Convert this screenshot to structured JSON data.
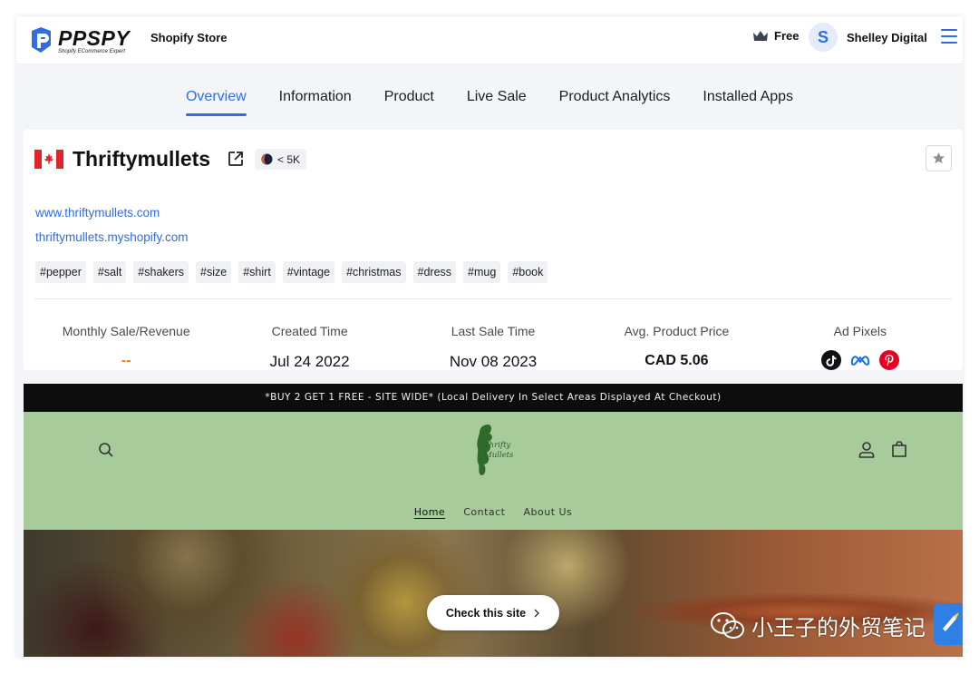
{
  "header": {
    "logo_text": "PPSPY",
    "logo_tagline": "Shopify ECommerce Expert",
    "page_type": "Shopify Store",
    "plan_label": "Free",
    "user_initial": "S",
    "user_name": "Shelley Digital",
    "accent_color": "#2f6de1"
  },
  "tabs": [
    {
      "label": "Overview",
      "active": true
    },
    {
      "label": "Information",
      "active": false
    },
    {
      "label": "Product",
      "active": false
    },
    {
      "label": "Live Sale",
      "active": false
    },
    {
      "label": "Product Analytics",
      "active": false
    },
    {
      "label": "Installed Apps",
      "active": false
    }
  ],
  "store": {
    "country_flag": "canada-flag-icon",
    "name": "Thriftymullets",
    "traffic_badge": "< 5K",
    "domains": [
      "www.thriftymullets.com",
      "thriftymullets.myshopify.com"
    ],
    "tags": [
      "pepper",
      "salt",
      "shakers",
      "size",
      "shirt",
      "vintage",
      "christmas",
      "dress",
      "mug",
      "book"
    ],
    "tag_prefix": "#"
  },
  "stats": {
    "monthly": {
      "label": "Monthly Sale/Revenue",
      "value": "--"
    },
    "created": {
      "label": "Created Time",
      "value": "Jul 24 2022"
    },
    "last_sale": {
      "label": "Last Sale Time",
      "value": "Nov 08 2023"
    },
    "avg_price": {
      "label": "Avg. Product Price",
      "value": "CAD 5.06"
    },
    "ad_pixels": {
      "label": "Ad Pixels",
      "icons": [
        "tiktok-icon",
        "meta-icon",
        "pinterest-icon"
      ]
    }
  },
  "preview": {
    "announcement": "*BUY 2 GET 1 FREE - SITE WIDE* (Local Delivery In Select Areas Displayed At Checkout)",
    "logo_line1": "Thrifty",
    "logo_line2": "Mullets",
    "nav": [
      {
        "label": "Home",
        "current": true
      },
      {
        "label": "Contact",
        "current": false
      },
      {
        "label": "About Us",
        "current": false
      }
    ],
    "check_button": "Check this site",
    "header_color": "#a8cb9c"
  },
  "watermark": "小王子的外贸笔记"
}
